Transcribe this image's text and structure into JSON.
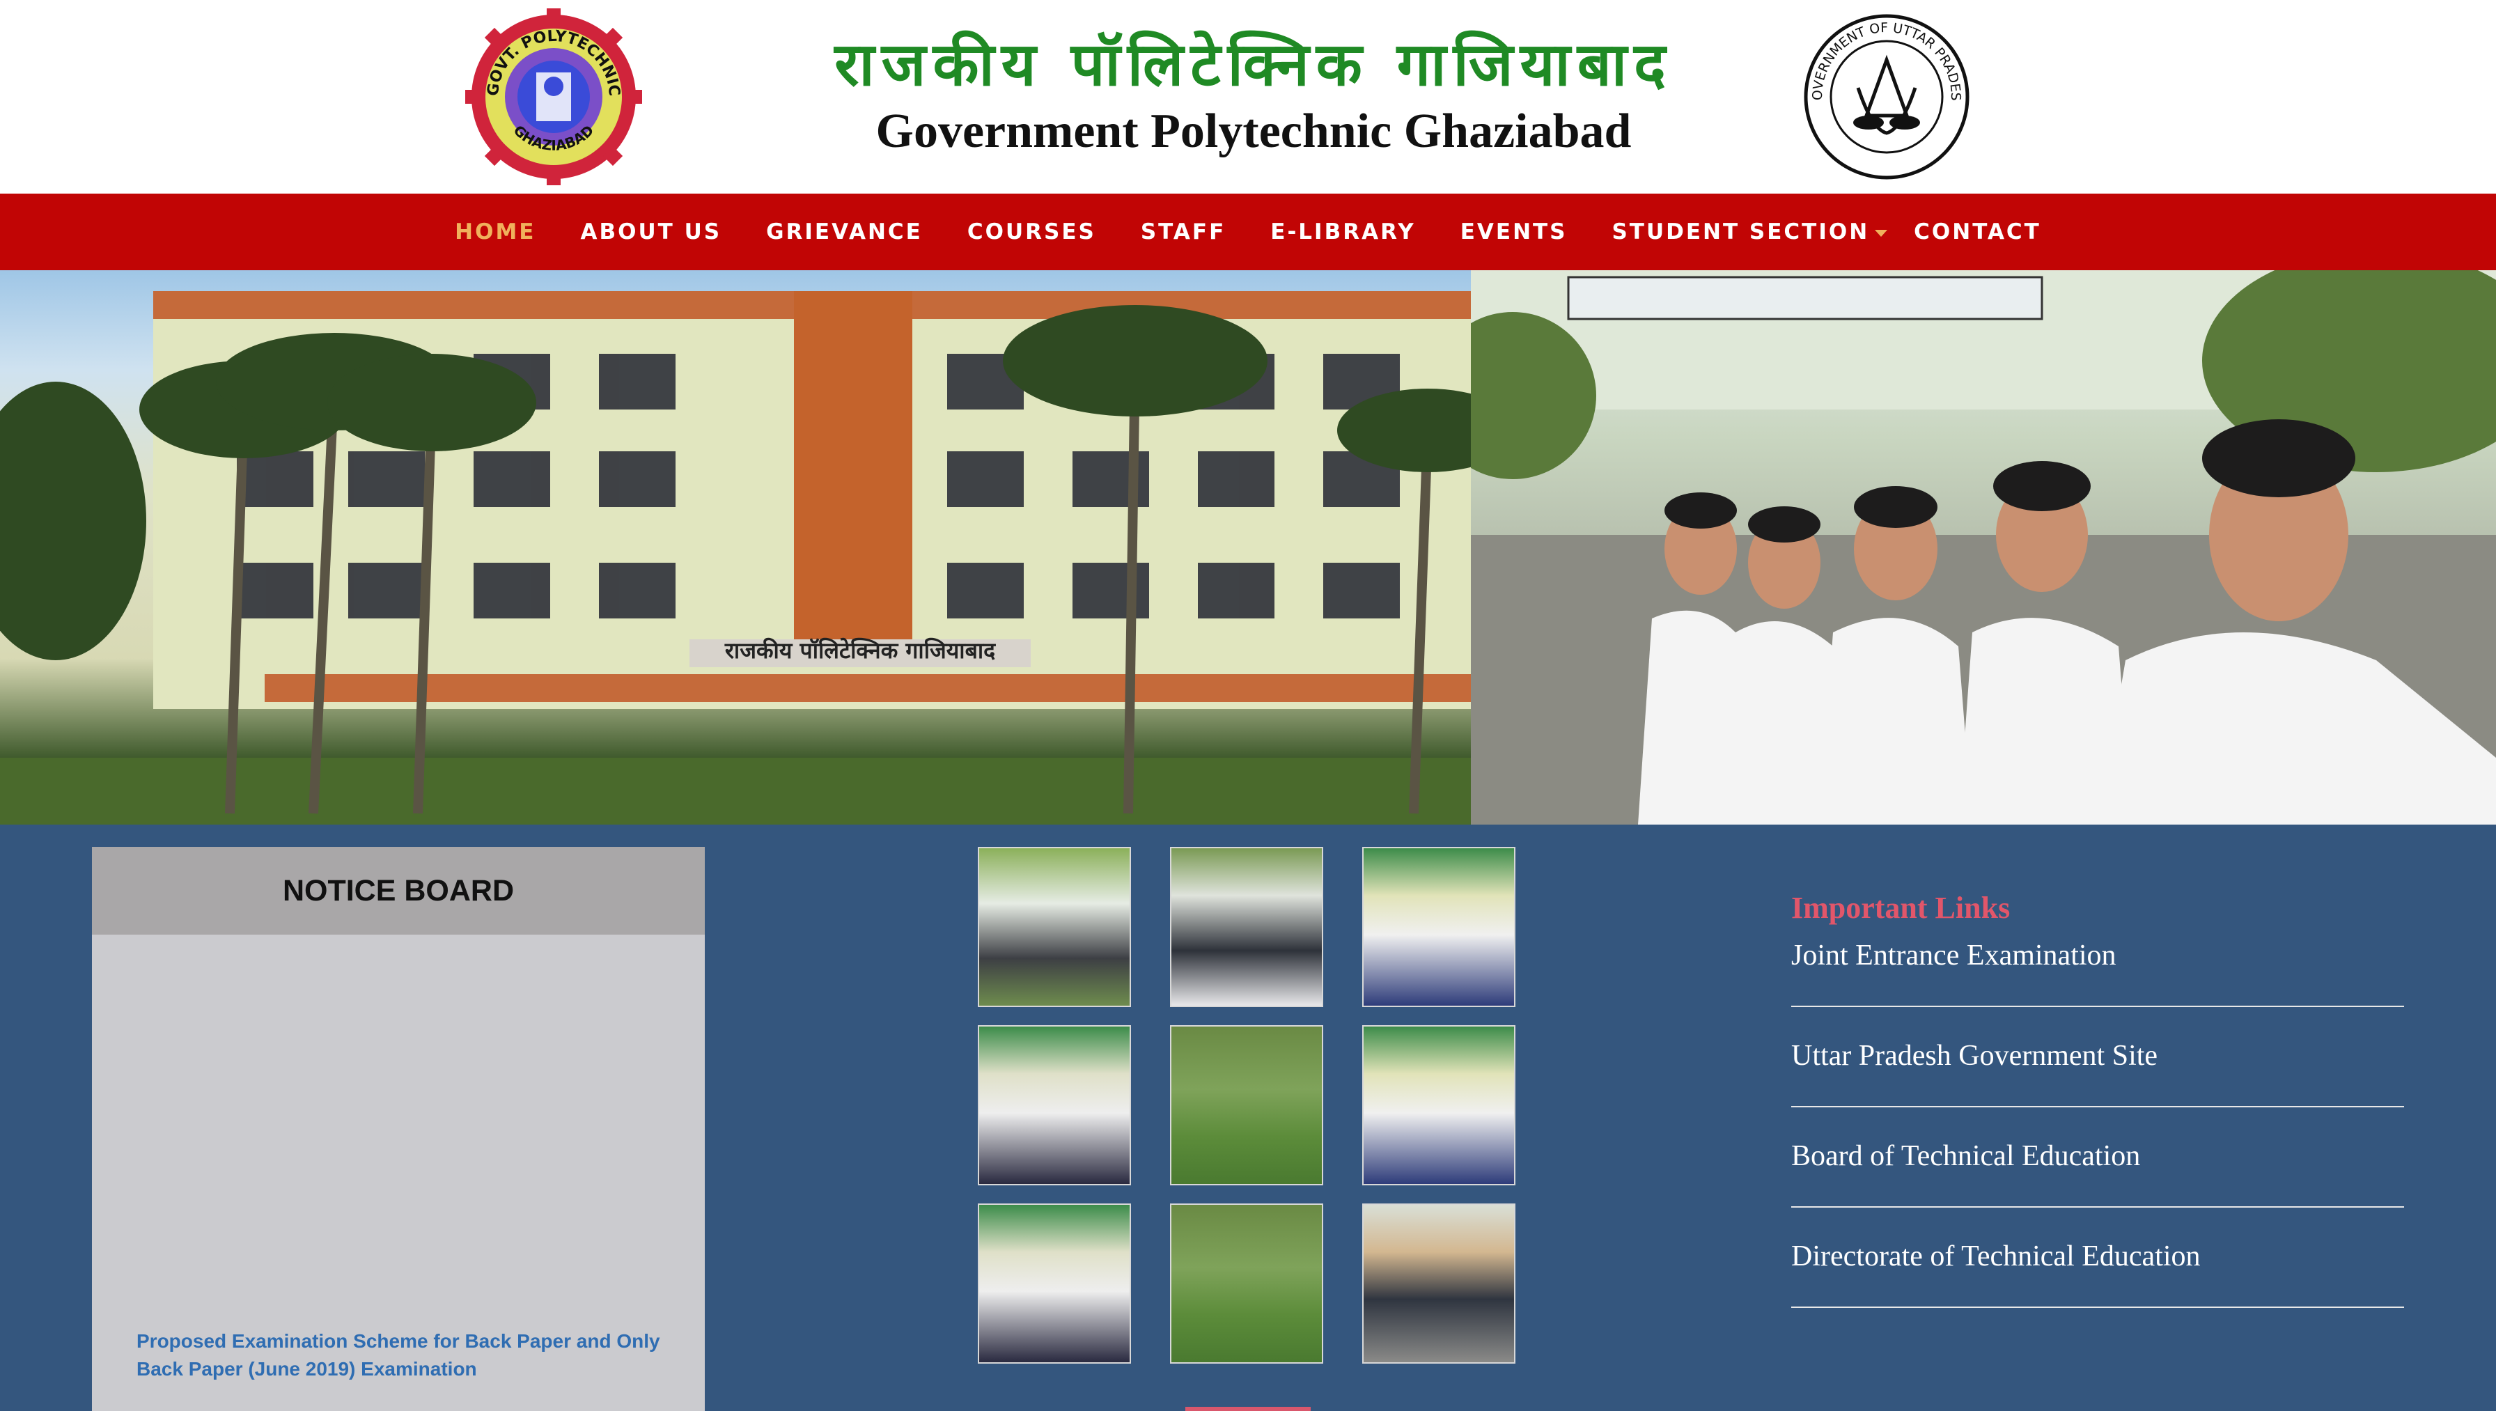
{
  "header": {
    "hindi_title": "राजकीय पॉलिटेक्निक गाजियाबाद",
    "english_title": "Government Polytechnic Ghaziabad",
    "left_logo": {
      "ring_text_top": "GOVT. POLYTECHNIC",
      "ring_text_bottom": "GHAZIABAD"
    },
    "right_logo": {
      "ring_text": "GOVERNMENT OF UTTAR PRADESH"
    }
  },
  "nav": {
    "items": [
      {
        "label": "HOME",
        "active": true
      },
      {
        "label": "ABOUT US"
      },
      {
        "label": "GRIEVANCE"
      },
      {
        "label": "COURSES"
      },
      {
        "label": "STAFF"
      },
      {
        "label": "E-LIBRARY"
      },
      {
        "label": "EVENTS"
      },
      {
        "label": "STUDENT SECTION",
        "has_dropdown": true
      },
      {
        "label": "CONTACT"
      }
    ]
  },
  "banner": {
    "building_sign": "राजकीय पॉलिटेक्निक गाजियाबाद"
  },
  "notice_board": {
    "title": "NOTICE BOARD",
    "items": [
      {
        "text": "Proposed Examination Scheme for Back Paper and Only Back Paper (June 2019) Examination"
      }
    ]
  },
  "important_links": {
    "title": "Important Links",
    "items": [
      {
        "label": "Joint Entrance Examination"
      },
      {
        "label": "Uttar Pradesh Government Site"
      },
      {
        "label": "Board of Technical Education"
      },
      {
        "label": "Directorate of Technical Education"
      }
    ]
  },
  "colors": {
    "nav_bg": "#c10505",
    "nav_active": "#f0b15c",
    "page_bg": "#34567e",
    "hindi_title": "#1f8a24",
    "links_title": "#e2566a",
    "notice_link": "#2f6db2"
  }
}
